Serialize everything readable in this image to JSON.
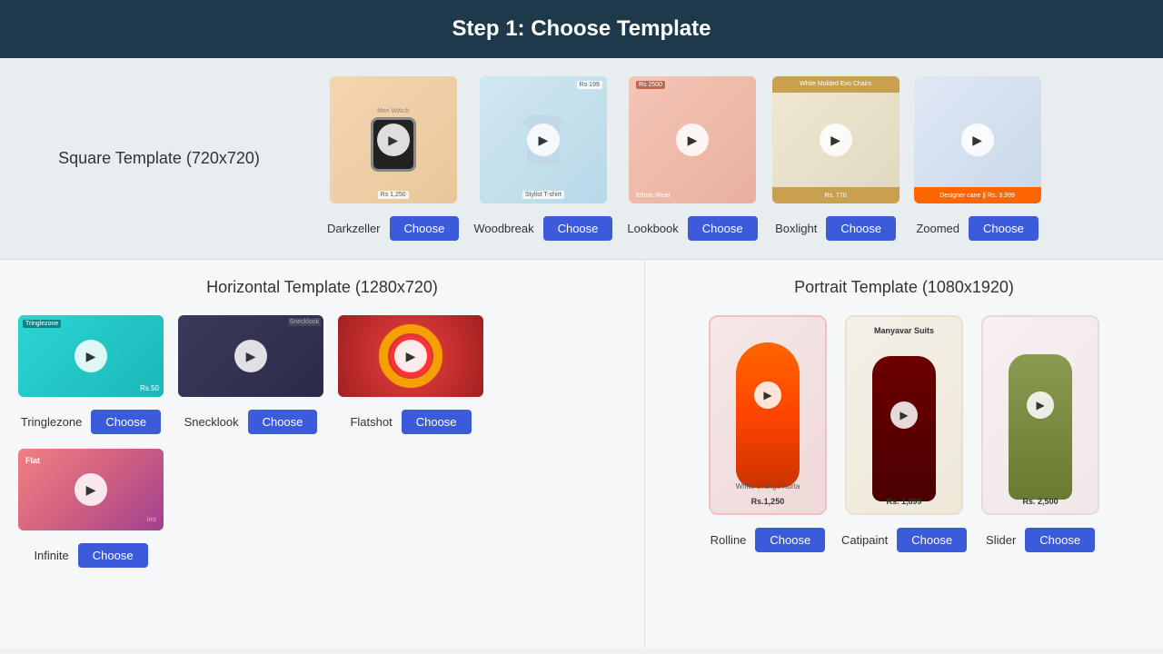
{
  "header": {
    "title": "Step 1: Choose Template"
  },
  "square_section": {
    "label": "Square Template (720x720)",
    "templates": [
      {
        "name": "Darkzeller",
        "btn": "Choose"
      },
      {
        "name": "Woodbreak",
        "btn": "Choose"
      },
      {
        "name": "Lookbook",
        "btn": "Choose"
      },
      {
        "name": "Boxlight",
        "btn": "Choose"
      },
      {
        "name": "Zoomed",
        "btn": "Choose"
      }
    ]
  },
  "horizontal_section": {
    "label": "Horizontal Template (1280x720)",
    "templates": [
      {
        "name": "Tringlezone",
        "btn": "Choose"
      },
      {
        "name": "Snecklook",
        "btn": "Choose"
      },
      {
        "name": "Flatshot",
        "btn": "Choose"
      },
      {
        "name": "Infinite",
        "btn": "Choose"
      }
    ]
  },
  "portrait_section": {
    "label": "Portrait Template (1080x1920)",
    "templates": [
      {
        "name": "Rolline",
        "btn": "Choose",
        "product": "White Orange Kurta",
        "price": "Rs.1,250"
      },
      {
        "name": "Catipaint",
        "btn": "Choose",
        "brand": "Manyavar Suits",
        "price": "Rs. 1,899"
      },
      {
        "name": "Slider",
        "btn": "Choose",
        "price": "Rs. 2,500"
      }
    ]
  },
  "colors": {
    "header_bg": "#1e3a4a",
    "choose_btn_bg": "#3b5bdb"
  }
}
